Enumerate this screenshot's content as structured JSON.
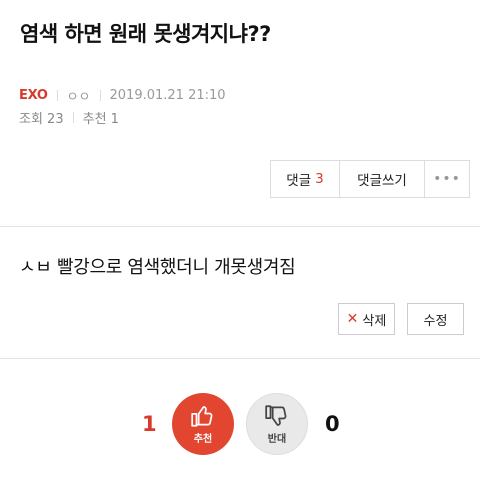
{
  "post": {
    "title": "염색 하면 원래 못생겨지냐??",
    "author": "EXO",
    "author_sub": "ㅇㅇ",
    "datetime": "2019.01.21 21:10",
    "views": "조회 23",
    "recommend": "추천 1",
    "content": "ㅅㅂ 빨강으로 염색했더니 개못생겨짐"
  },
  "actions": {
    "comments_label": "댓글",
    "comments_count": "3",
    "write_comment_label": "댓글쓰기",
    "more_label": "•••",
    "delete_label": "삭제",
    "edit_label": "수정"
  },
  "vote": {
    "up_count": "1",
    "up_label": "추천",
    "down_count": "0",
    "down_label": "반대"
  },
  "colors": {
    "accent": "#d83a2b",
    "upvote_bg": "#e34630",
    "downvote_bg": "#e9e9e9"
  },
  "icons": [
    "thumbs-up-icon",
    "thumbs-down-icon",
    "close-icon",
    "more-icon"
  ]
}
